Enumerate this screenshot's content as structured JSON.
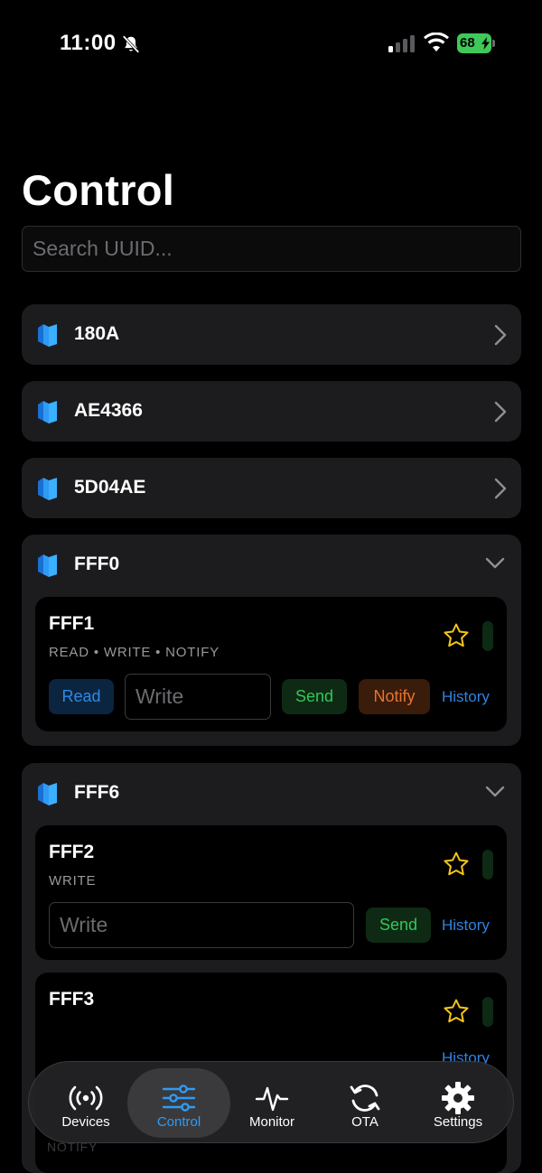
{
  "status_bar": {
    "time": "11:00",
    "battery": "68",
    "icons": [
      "bell-slash-icon",
      "signal-icon",
      "wifi-icon",
      "battery-charging-icon"
    ],
    "battery_color": "#3ec95a"
  },
  "page": {
    "title": "Control"
  },
  "search": {
    "placeholder": "Search UUID..."
  },
  "services": [
    {
      "name": "180A",
      "expanded": false
    },
    {
      "name": "AE4366",
      "expanded": false
    },
    {
      "name": "5D04AE",
      "expanded": false
    },
    {
      "name": "FFF0",
      "expanded": true,
      "characteristics": [
        {
          "name": "FFF1",
          "properties": "READ • WRITE • NOTIFY",
          "read_label": "Read",
          "write_placeholder": "Write",
          "send_label": "Send",
          "notify_label": "Notify",
          "history_label": "History"
        }
      ]
    },
    {
      "name": "FFF6",
      "expanded": true,
      "characteristics": [
        {
          "name": "FFF2",
          "properties": "WRITE",
          "write_placeholder": "Write",
          "send_label": "Send",
          "history_label": "History"
        },
        {
          "name": "FFF3",
          "properties": "NOTIFY",
          "history_label": "History"
        }
      ]
    }
  ],
  "tab_bar": {
    "tabs": [
      {
        "label": "Devices",
        "icon": "broadcast-icon",
        "active": false
      },
      {
        "label": "Control",
        "icon": "sliders-icon",
        "active": true
      },
      {
        "label": "Monitor",
        "icon": "waveform-icon",
        "active": false
      },
      {
        "label": "OTA",
        "icon": "refresh-icon",
        "active": false
      },
      {
        "label": "Settings",
        "icon": "gear-icon",
        "active": false
      }
    ],
    "accent_color": "#2f9bf5"
  }
}
